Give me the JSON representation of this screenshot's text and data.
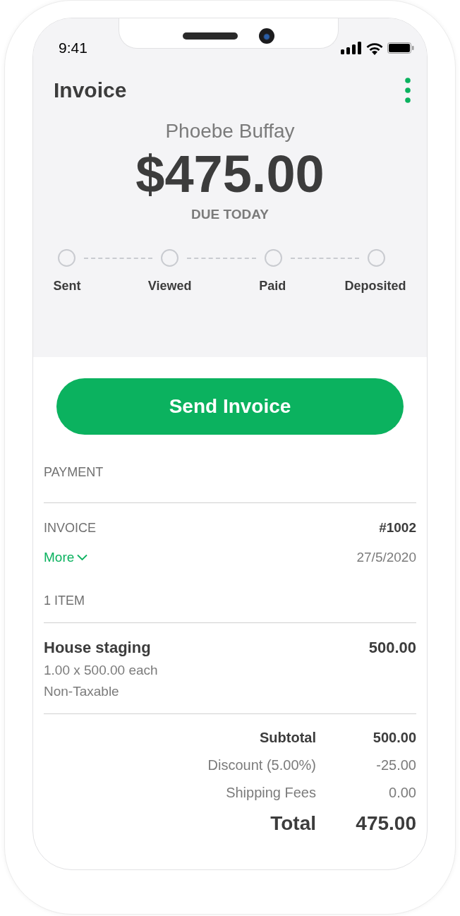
{
  "status_bar": {
    "time": "9:41"
  },
  "header": {
    "title": "Invoice"
  },
  "summary": {
    "customer": "Phoebe Buffay",
    "amount": "$475.00",
    "due": "DUE TODAY"
  },
  "steps": [
    {
      "label": "Sent",
      "done": false
    },
    {
      "label": "Viewed",
      "done": false
    },
    {
      "label": "Paid",
      "done": false
    },
    {
      "label": "Deposited",
      "done": false
    }
  ],
  "send_button": "Send Invoice",
  "payment": {
    "heading": "PAYMENT"
  },
  "invoice": {
    "label": "INVOICE",
    "number": "#1002",
    "more": "More",
    "expanded": false,
    "date": "27/5/2020"
  },
  "items": {
    "heading": "1 ITEM",
    "rows": [
      {
        "name": "House staging",
        "amount": "500.00",
        "detail": "1.00 x 500.00 each",
        "tax": "Non-Taxable"
      }
    ]
  },
  "totals": [
    {
      "label": "Subtotal",
      "value": "500.00",
      "kind": "subtotal"
    },
    {
      "label": "Discount (5.00%)",
      "value": "-25.00",
      "kind": "line"
    },
    {
      "label": "Shipping Fees",
      "value": "0.00",
      "kind": "line"
    },
    {
      "label": "Total",
      "value": "475.00",
      "kind": "total"
    }
  ]
}
